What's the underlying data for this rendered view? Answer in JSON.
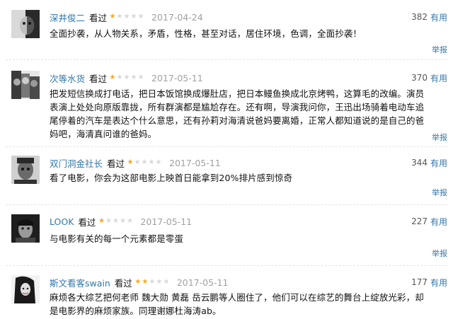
{
  "useful_label": "有用",
  "watched_label": "看过",
  "report_label": "举报",
  "reviews": [
    {
      "user": "深井俊二",
      "rating": 1,
      "date": "2017-04-24",
      "votes": "382",
      "content": "全面抄袭，从人物关系，矛盾，性格，甚至对话，居住环境，色调，全面抄袭！"
    },
    {
      "user": "次等水货",
      "rating": 1,
      "date": "2017-05-11",
      "votes": "370",
      "content": "把发短信换成打电话，把日本饭馆换成爆肚店，把日本鳗鱼换成北京烤鸭，这算毛的改编。演员表演上处处向原版靠拢，所有群演都是尴尬存在。还有啊，导演我问你，王迅出场骑着电动车追尾停着的汽车是表达个什么意思，还有孙莉对海清说爸妈要离婚，正常人都知道说的是自己的爸妈吧，海清真问谁的爸妈。"
    },
    {
      "user": "双门洞金社长",
      "rating": 1,
      "date": "2017-05-11",
      "votes": "344",
      "content": "看了电影，你会为这部电影上映首日能拿到20%排片感到惊奇"
    },
    {
      "user": "LOOK",
      "rating": 1,
      "date": "2017-05-11",
      "votes": "227",
      "content": "与电影有关的每一个元素都是零蛋"
    },
    {
      "user": "斯文看客swain",
      "rating": 2,
      "date": "2017-05-11",
      "votes": "177",
      "content": "麻烦各大综艺把何老师 魏大勋 黄磊 岳云鹏等人圈住了，他们可以在综艺的舞台上绽放光彩，却是电影界的麻烦家族。同理谢娜杜海涛ab。"
    }
  ],
  "colors": {
    "link": "#3377aa",
    "star_on": "#f4a91f",
    "star_off": "#d8d8d8",
    "date": "#a0a0a0"
  }
}
